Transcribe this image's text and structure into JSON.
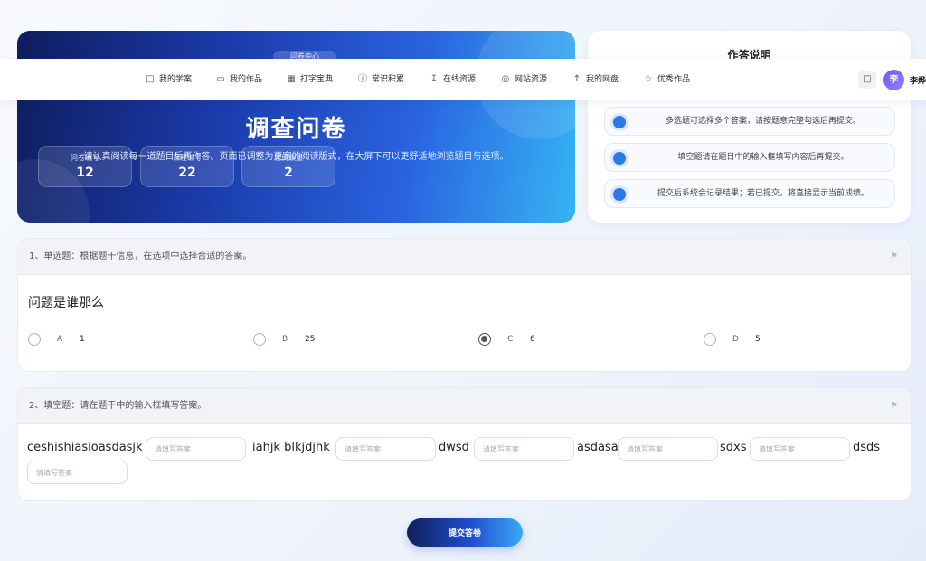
{
  "hero": {
    "tag": "问卷中心",
    "title": "调查问卷",
    "subtitle": "请认真阅读每一道题目后再作答。页面已调整为更宽的阅读版式，在大屏下可以更舒适地浏览题目与选项。",
    "stats": [
      {
        "label": "问卷编号",
        "value": "12"
      },
      {
        "label": "课程编号",
        "value": "22"
      },
      {
        "label": "题目数量",
        "value": "2"
      }
    ]
  },
  "instructions": {
    "title": "作答说明",
    "items": [
      "多选题可选择多个答案，请按题意完整勾选后再提交。",
      "填空题请在题目中的输入框填写内容后再提交。",
      "提交后系统会记录结果；若已提交，将直接显示当前成绩。"
    ]
  },
  "nav": {
    "items": [
      {
        "label": "我的学案",
        "icon": "book-icon"
      },
      {
        "label": "我的作品",
        "icon": "folder-icon"
      },
      {
        "label": "打字宝典",
        "icon": "keyboard-icon"
      },
      {
        "label": "常识积累",
        "icon": "help-circle-icon"
      },
      {
        "label": "在线资源",
        "icon": "download-icon"
      },
      {
        "label": "网站资源",
        "icon": "globe-icon"
      },
      {
        "label": "我的网盘",
        "icon": "upload-icon"
      },
      {
        "label": "优秀作品",
        "icon": "star-icon"
      }
    ],
    "avatar_char": "李",
    "username": "李烨"
  },
  "question1": {
    "header": "1、单选题：根据题干信息，在选项中选择合适的答案。",
    "text": "问题是谁那么",
    "options": [
      {
        "letter": "A",
        "value": "1",
        "selected": false
      },
      {
        "letter": "B",
        "value": "25",
        "selected": false
      },
      {
        "letter": "C",
        "value": "6",
        "selected": true
      },
      {
        "letter": "D",
        "value": "5",
        "selected": false
      }
    ]
  },
  "question2": {
    "header": "2、填空题：请在题干中的输入框填写答案。",
    "words": [
      "ceshishiasioasdasjk",
      "iahjk blkjdjhk",
      "dwsd",
      "asdasa",
      "sdxs",
      "dsds"
    ],
    "placeholder": "请填写答案"
  },
  "submit_label": "提交答卷",
  "colors": {
    "accent": "#2a7ae8",
    "hero_dark": "#0e1d5e",
    "hero_light": "#35b4f4"
  }
}
